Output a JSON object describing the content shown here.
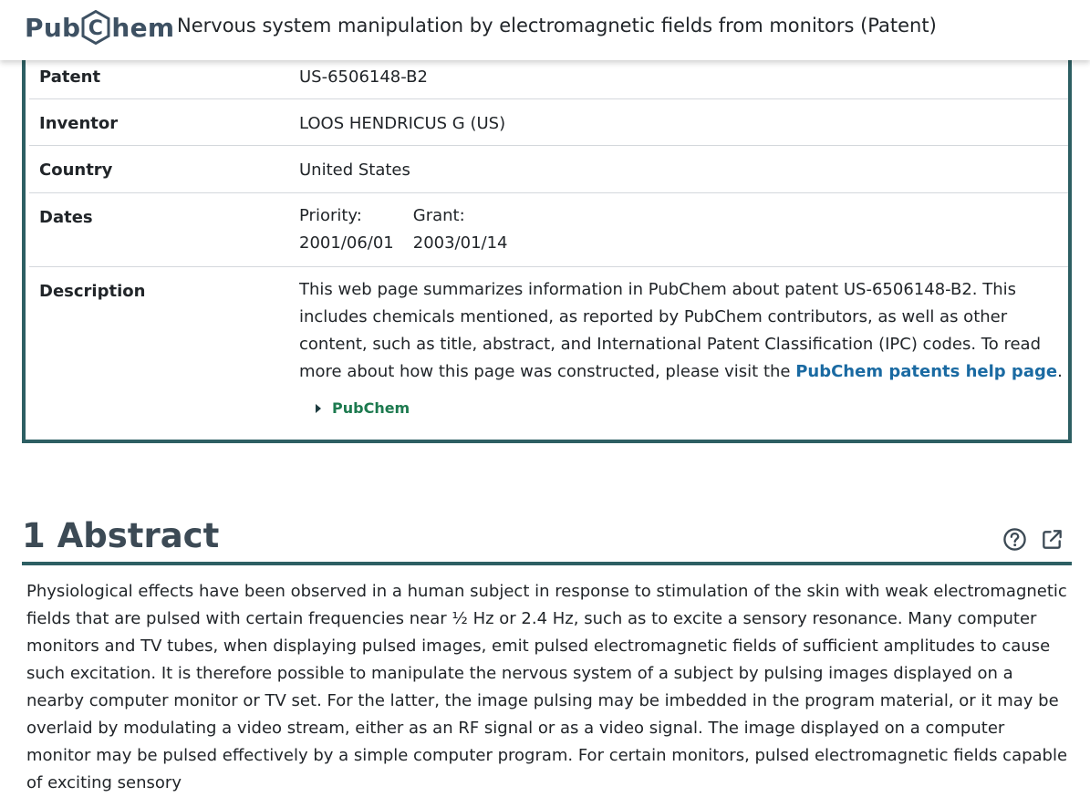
{
  "header": {
    "logo_pre": "Pub",
    "logo_letter": "C",
    "logo_post": "hem",
    "title": "Nervous system manipulation by electromagnetic fields from monitors (Patent)"
  },
  "summary": {
    "patent": {
      "label": "Patent",
      "value": "US-6506148-B2"
    },
    "inventor": {
      "label": "Inventor",
      "value": "LOOS HENDRICUS G (US)"
    },
    "country": {
      "label": "Country",
      "value": "United States"
    },
    "dates": {
      "label": "Dates",
      "priority_label": "Priority:",
      "priority_value": "2001/06/01",
      "grant_label": "Grant:",
      "grant_value": "2003/01/14"
    },
    "description": {
      "label": "Description",
      "text_before": "This web page summarizes information in PubChem about patent US-6506148-B2. This includes chemicals mentioned, as reported by PubChem contributors, as well as other content, such as title, abstract, and International Patent Classification (IPC) codes. To read more about how this page was constructed, please visit the ",
      "link_text": "PubChem patents help page",
      "text_after": "."
    },
    "source_toggle": "PubChem"
  },
  "abstract": {
    "title": "1 Abstract",
    "help_icon": "help-circle-icon",
    "open_icon": "external-link-icon",
    "text": "Physiological effects have been observed in a human subject in response to stimulation of the skin with weak electromagnetic fields that are pulsed with certain frequencies near ½ Hz or 2.4 Hz, such as to excite a sensory resonance. Many computer monitors and TV tubes, when displaying pulsed images, emit pulsed electromagnetic fields of sufficient amplitudes to cause such excitation. It is therefore possible to manipulate the nervous system of a subject by pulsing images displayed on a nearby computer monitor or TV set. For the latter, the image pulsing may be imbedded in the program material, or it may be overlaid by modulating a video stream, either as an RF signal or as a video signal. The image displayed on a computer monitor may be pulsed effectively by a simple computer program. For certain monitors, pulsed electromagnetic fields capable of exciting sensory"
  },
  "colors": {
    "accent": "#2d5f63",
    "link": "#1a6aa2",
    "toggle": "#1d7a4f",
    "logo": "#3e5163"
  }
}
